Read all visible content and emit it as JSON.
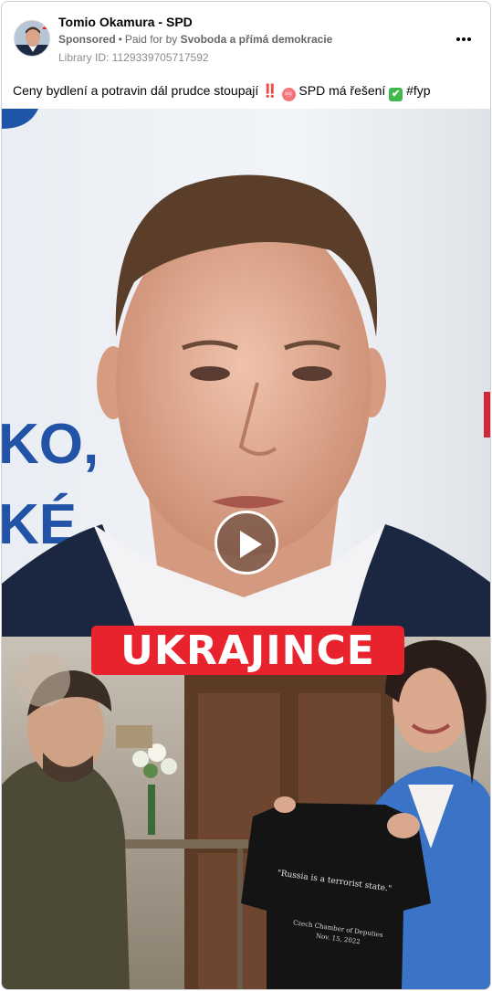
{
  "post": {
    "page_name": "Tomio Okamura - SPD",
    "sponsored_label": "Sponsored",
    "separator": "•",
    "paid_for_prefix": "Paid for by",
    "funder": "Svoboda a přímá demokracie",
    "library_id": "Library ID: 1129339705717592",
    "more_icon": "more-horizontal-icon"
  },
  "caption": {
    "text_before": "Ceny bydlení a potravin dál prudce stoupají",
    "bang_emoji": "‼️",
    "infinity_emoji": "♾",
    "middle_text": "SPD má řešení",
    "check_emoji": "✔",
    "hashtag": "#fyp"
  },
  "media": {
    "type": "video",
    "play_icon": "play-icon",
    "overlay_text": "UKRAJINCE",
    "backdrop_text_1": "KO,",
    "backdrop_text_2": "KÉ",
    "shirt_quote": "\"Russia is a terrorist state.\"",
    "shirt_signature_1": "Czech Chamber of Deputies",
    "shirt_signature_2": "Nov. 15, 2022"
  },
  "colors": {
    "accent_red": "#e8232e",
    "text_primary": "#050505",
    "text_secondary": "#65676b",
    "border": "#ced0d4"
  }
}
